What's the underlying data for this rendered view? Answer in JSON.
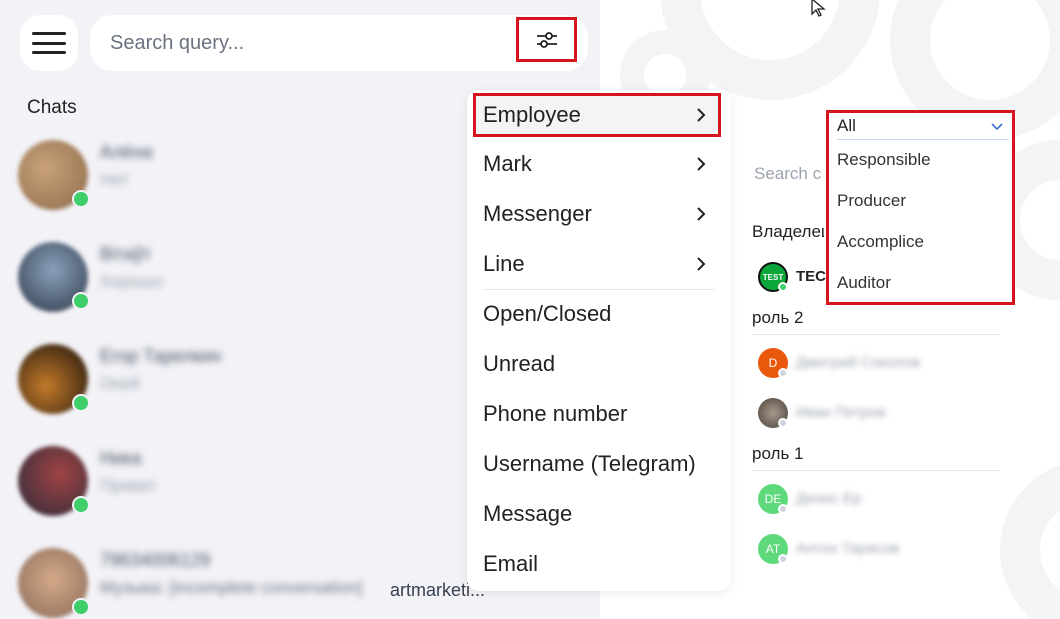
{
  "search": {
    "placeholder": "Search query..."
  },
  "chats": {
    "title": "Chats",
    "items": [
      {
        "name": "Алёна",
        "preview": "Нет",
        "colors": [
          "#c9a27a",
          "#8c6a4a"
        ]
      },
      {
        "name": "Вітаўт",
        "preview": "Хорошо",
        "colors": [
          "#6b7f9a",
          "#2f3a4a"
        ]
      },
      {
        "name": "Егор Тарелкин",
        "preview": "Окей",
        "colors": [
          "#3a2a1f",
          "#c27a2a"
        ]
      },
      {
        "name": "Ника",
        "preview": "Привет",
        "colors": [
          "#7a3a3a",
          "#2a2a3a"
        ]
      },
      {
        "name": "79634006129",
        "preview_prefix": "Музыка:",
        "preview": "[incomplete conversation]",
        "preview_tail": "artmarketi...",
        "colors": [
          "#c49a7a",
          "#8a6a5a"
        ]
      }
    ]
  },
  "filter_menu": {
    "items": [
      {
        "label": "Employee",
        "arrow": true
      },
      {
        "label": "Mark",
        "arrow": true
      },
      {
        "label": "Messenger",
        "arrow": true
      },
      {
        "label": "Line",
        "arrow": true
      },
      {
        "label": "Open/Closed",
        "arrow": false
      },
      {
        "label": "Unread",
        "arrow": false
      },
      {
        "label": "Phone number",
        "arrow": false
      },
      {
        "label": "Username (Telegram)",
        "arrow": false
      },
      {
        "label": "Message",
        "arrow": false
      },
      {
        "label": "Email",
        "arrow": false
      }
    ]
  },
  "role_dropdown": {
    "selected": "All",
    "options": [
      "Responsible",
      "Producer",
      "Accomplice",
      "Auditor"
    ]
  },
  "employee_panel": {
    "search_placeholder": "Search c",
    "groups": [
      {
        "title": "Владелец",
        "members": [
          {
            "avatar_text": "TEST",
            "name": "TEC",
            "blurred": false,
            "avatar_color": "#0aa63a",
            "status_color": "#3ecf6a"
          }
        ]
      },
      {
        "title": "роль 2",
        "members": [
          {
            "avatar_text": "D",
            "name": "Дмитрий Соколов",
            "blurred": true,
            "avatar_color": "#ea580c",
            "status_color": "#d1d5db"
          },
          {
            "avatar_text": "",
            "name": "Иван Петров",
            "blurred": true,
            "avatar_color": "#6b6057",
            "status_color": "#d1d5db"
          }
        ]
      },
      {
        "title": "роль 1",
        "members": [
          {
            "avatar_text": "DE",
            "name": "Денис Ер",
            "blurred": true,
            "avatar_color": "#5dd87a",
            "status_color": "#d1d5db"
          },
          {
            "avatar_text": "AT",
            "name": "Антон Тарасов",
            "blurred": true,
            "avatar_color": "#5dd87a",
            "status_color": "#d1d5db"
          }
        ]
      }
    ]
  },
  "colors": {
    "highlight": "#d6141e",
    "online": "#3ecf6a",
    "panel_bg": "#f2f2f7"
  }
}
